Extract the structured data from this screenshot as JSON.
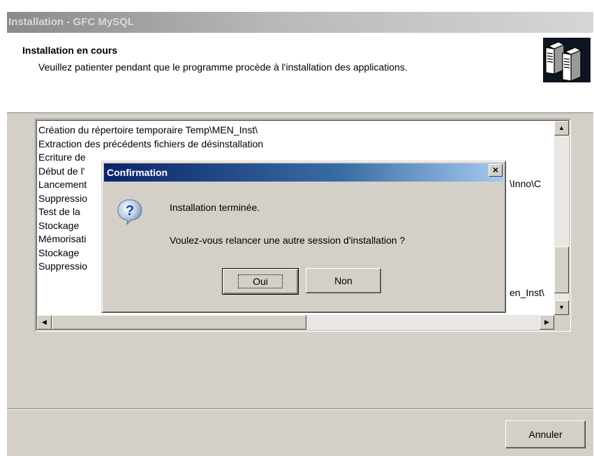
{
  "window": {
    "title": "Installation - GFC MySQL"
  },
  "header": {
    "title": "Installation en cours",
    "description": "Veuillez patienter pendant que le programme procède à l'installation des applications.",
    "logo_icon": "computer-servers-icon"
  },
  "log": {
    "lines": [
      "Création du répertoire temporaire Temp\\MEN_Inst\\",
      "Extraction des précédents fichiers de désinstallation",
      "Ecriture de",
      "Début de l'",
      "Lancement",
      "Suppressio",
      "Test de la ",
      "Stockage ",
      "Mémorisati",
      "Stockage ",
      "Suppressio"
    ],
    "right_fragments": [
      {
        "line": 5,
        "text": "\\Inno\\C"
      },
      {
        "line": 11,
        "text": "en_Inst\\"
      }
    ]
  },
  "dialog": {
    "title": "Confirmation",
    "icon": "question-icon",
    "message1": "Installation terminée.",
    "message2": "Voulez-vous relancer une autre session d'installation ?",
    "yes_label": "Oui",
    "no_label": "Non"
  },
  "footer": {
    "cancel_label": "Annuler"
  },
  "colors": {
    "dialog_title_start": "#0a246a",
    "dialog_title_end": "#a6caf0",
    "face": "#d4d0c8"
  }
}
